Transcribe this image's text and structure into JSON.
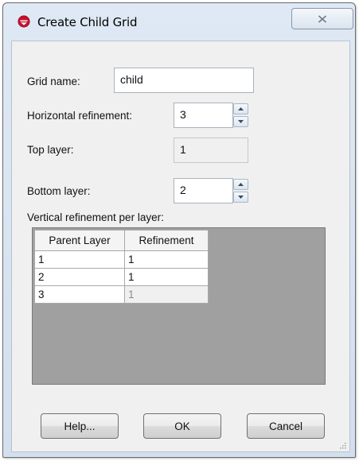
{
  "window": {
    "title": "Create Child Grid",
    "app_icon": "gms-logo-icon",
    "accent_color": "#c8102e"
  },
  "form": {
    "grid_name_label": "Grid name:",
    "grid_name_value": "child",
    "horizontal_refinement_label": "Horizontal refinement:",
    "horizontal_refinement_value": "3",
    "top_layer_label": "Top layer:",
    "top_layer_value": "1",
    "bottom_layer_label": "Bottom layer:",
    "bottom_layer_value": "2",
    "vertical_refinement_label": "Vertical refinement per layer:"
  },
  "table": {
    "columns": [
      "Parent Layer",
      "Refinement"
    ],
    "rows": [
      {
        "parent_layer": "1",
        "refinement": "1"
      },
      {
        "parent_layer": "2",
        "refinement": "1"
      },
      {
        "parent_layer": "3",
        "refinement": "1"
      }
    ]
  },
  "buttons": {
    "help": "Help...",
    "ok": "OK",
    "cancel": "Cancel"
  }
}
